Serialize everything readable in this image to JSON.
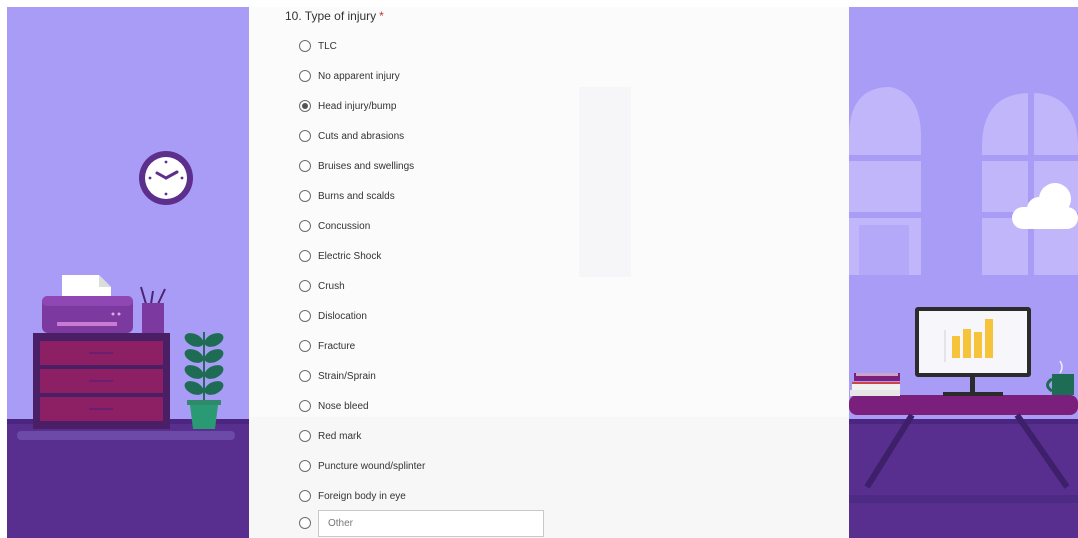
{
  "question": {
    "title": "10. Type of injury",
    "required_mark": "*",
    "selected_option": "Head injury/bump",
    "options": [
      {
        "label": "TLC",
        "selected": false
      },
      {
        "label": "No apparent injury",
        "selected": false
      },
      {
        "label": "Head injury/bump",
        "selected": true
      },
      {
        "label": "Cuts and abrasions",
        "selected": false
      },
      {
        "label": "Bruises and swellings",
        "selected": false
      },
      {
        "label": "Burns and scalds",
        "selected": false
      },
      {
        "label": "Concussion",
        "selected": false
      },
      {
        "label": "Electric Shock",
        "selected": false
      },
      {
        "label": "Crush",
        "selected": false
      },
      {
        "label": "Dislocation",
        "selected": false
      },
      {
        "label": "Fracture",
        "selected": false
      },
      {
        "label": "Strain/Sprain",
        "selected": false
      },
      {
        "label": "Nose bleed",
        "selected": false
      },
      {
        "label": "Red mark",
        "selected": false
      },
      {
        "label": "Puncture wound/splinter",
        "selected": false
      },
      {
        "label": "Foreign body in eye",
        "selected": false
      }
    ],
    "other": {
      "placeholder": "Other",
      "value": ""
    }
  },
  "theme": {
    "background": "#a99cf7",
    "floor": "#582f8e",
    "accent_magenta": "#6b1f6e",
    "clock_purple": "#5d2f8d",
    "plant_green": "#1f6c55",
    "chart_yellow": "#f5c43a"
  },
  "icons": [
    "clock-icon",
    "printer-icon",
    "pen-holder-icon",
    "plant-icon",
    "monitor-chart-icon",
    "books-icon",
    "mug-icon",
    "cloud-icon",
    "window-icon"
  ]
}
